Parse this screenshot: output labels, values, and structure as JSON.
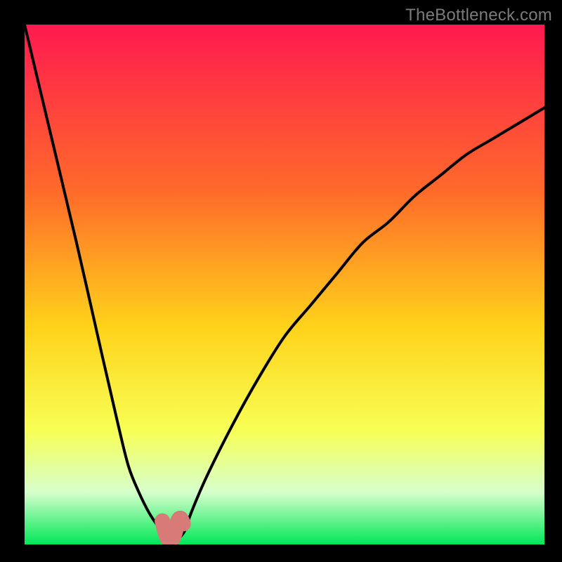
{
  "watermark": "TheBottleneck.com",
  "colors": {
    "frame": "#000000",
    "gradient_top": "#ff1a50",
    "gradient_mid1": "#ff6a2a",
    "gradient_mid2": "#ffd21a",
    "gradient_mid3": "#f7ff55",
    "gradient_low": "#d6ffcc",
    "gradient_bottom": "#00e756",
    "curve": "#000000",
    "marker": "#d87a77"
  },
  "chart_data": {
    "type": "line",
    "title": "",
    "xlabel": "",
    "ylabel": "",
    "ylim": [
      0,
      100
    ],
    "xlim": [
      0,
      100
    ],
    "series": [
      {
        "name": "bottleneck-curve",
        "x": [
          0,
          5,
          10,
          15,
          18,
          20,
          22,
          24,
          26,
          27,
          28,
          29,
          30,
          31,
          32,
          35,
          40,
          45,
          50,
          55,
          60,
          65,
          70,
          75,
          80,
          85,
          90,
          95,
          100
        ],
        "y": [
          100,
          79,
          58,
          36,
          23,
          15,
          10,
          6,
          3,
          1.5,
          1,
          1,
          1.5,
          3,
          6,
          13,
          23,
          32,
          40,
          46,
          52,
          58,
          62,
          67,
          71,
          75,
          78,
          81,
          84
        ]
      },
      {
        "name": "optimal-range-marker",
        "x": [
          26.5,
          27,
          27.5,
          28,
          28.5,
          29,
          29.5,
          30,
          30.5
        ],
        "y": [
          4.5,
          2.5,
          1.2,
          1,
          1.2,
          2.5,
          4.5,
          5,
          4
        ]
      }
    ],
    "optimal_x": 28,
    "optimal_y": 1
  }
}
